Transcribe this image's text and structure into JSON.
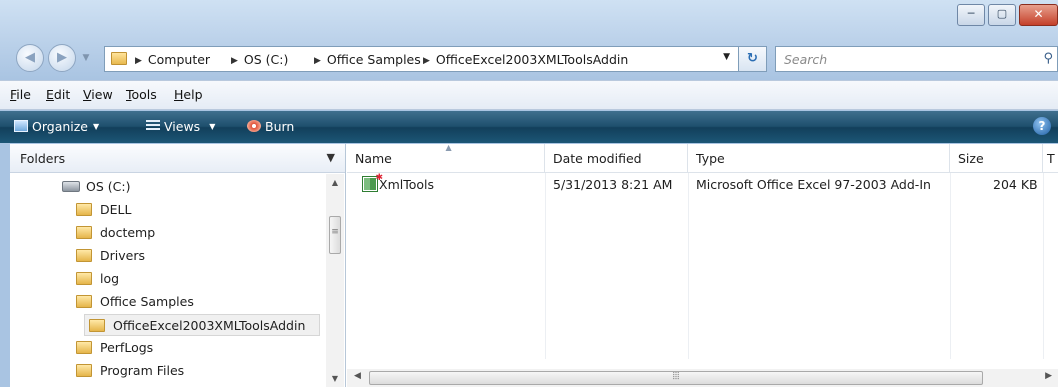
{
  "window": {
    "controls": {
      "minimize_glyph": "─",
      "maximize_glyph": "▢",
      "close_glyph": "✕"
    }
  },
  "nav": {
    "back_glyph": "◀",
    "forward_glyph": "▶",
    "recent_glyph": "▼",
    "breadcrumbs": [
      "Computer",
      "OS (C:)",
      "Office Samples",
      "OfficeExcel2003XMLToolsAddin"
    ],
    "refresh_glyph": "↻",
    "search_placeholder": "Search"
  },
  "menu": {
    "items": [
      {
        "key": "F",
        "rest": "ile"
      },
      {
        "key": "E",
        "rest": "dit"
      },
      {
        "key": "V",
        "rest": "iew"
      },
      {
        "key": "T",
        "rest": "ools"
      },
      {
        "key": "H",
        "rest": "elp"
      }
    ]
  },
  "toolbar": {
    "organize_label": "Organize",
    "views_label": "Views",
    "burn_label": "Burn",
    "help_label": "?"
  },
  "folders": {
    "header": "Folders",
    "tree": [
      {
        "label": "OS (C:)",
        "icon": "drive-icon"
      },
      {
        "label": "DELL",
        "icon": "folder-icon"
      },
      {
        "label": "doctemp",
        "icon": "folder-icon"
      },
      {
        "label": "Drivers",
        "icon": "folder-icon"
      },
      {
        "label": "log",
        "icon": "folder-icon"
      },
      {
        "label": "Office Samples",
        "icon": "folder-icon"
      },
      {
        "label": "OfficeExcel2003XMLToolsAddin",
        "icon": "folder-icon",
        "selected": true
      },
      {
        "label": "PerfLogs",
        "icon": "folder-icon"
      },
      {
        "label": "Program Files",
        "icon": "folder-icon"
      }
    ]
  },
  "filelist": {
    "columns": [
      "Name",
      "Date modified",
      "Type",
      "Size",
      "T"
    ],
    "rows": [
      {
        "name": "XmlTools",
        "date_modified": "5/31/2013 8:21 AM",
        "type": "Microsoft Office Excel 97-2003 Add-In",
        "size": "204 KB"
      }
    ]
  },
  "colors": {
    "command_bar": "#1e4f6d",
    "address_border": "#7f9db9",
    "selection_bg": "#f0f0f0"
  }
}
